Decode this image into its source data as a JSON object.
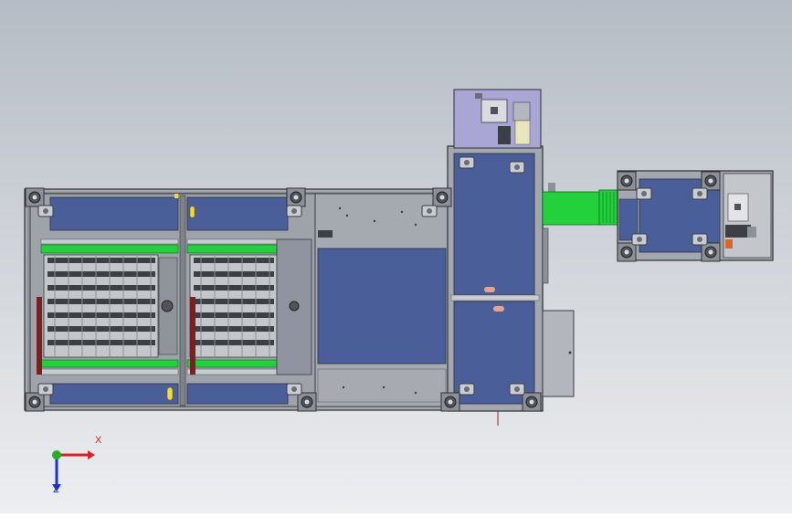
{
  "colors": {
    "bg_top": "#b6bcc5",
    "bg_bottom": "#e9ebee",
    "panel_blue": "#4a5f99",
    "frame_gray": "#a3a7ae",
    "frame_dark": "#55585d",
    "accent_green": "#22d13c",
    "roller_dark": "#3c3f44",
    "cabinet_purple": "#a9a6d6",
    "pad_pink": "#e7a28c",
    "axis_x": "#e02020",
    "axis_y": "#22b022",
    "axis_z": "#2030d8"
  },
  "triad": {
    "x_label": "X",
    "z_label": "Z"
  }
}
